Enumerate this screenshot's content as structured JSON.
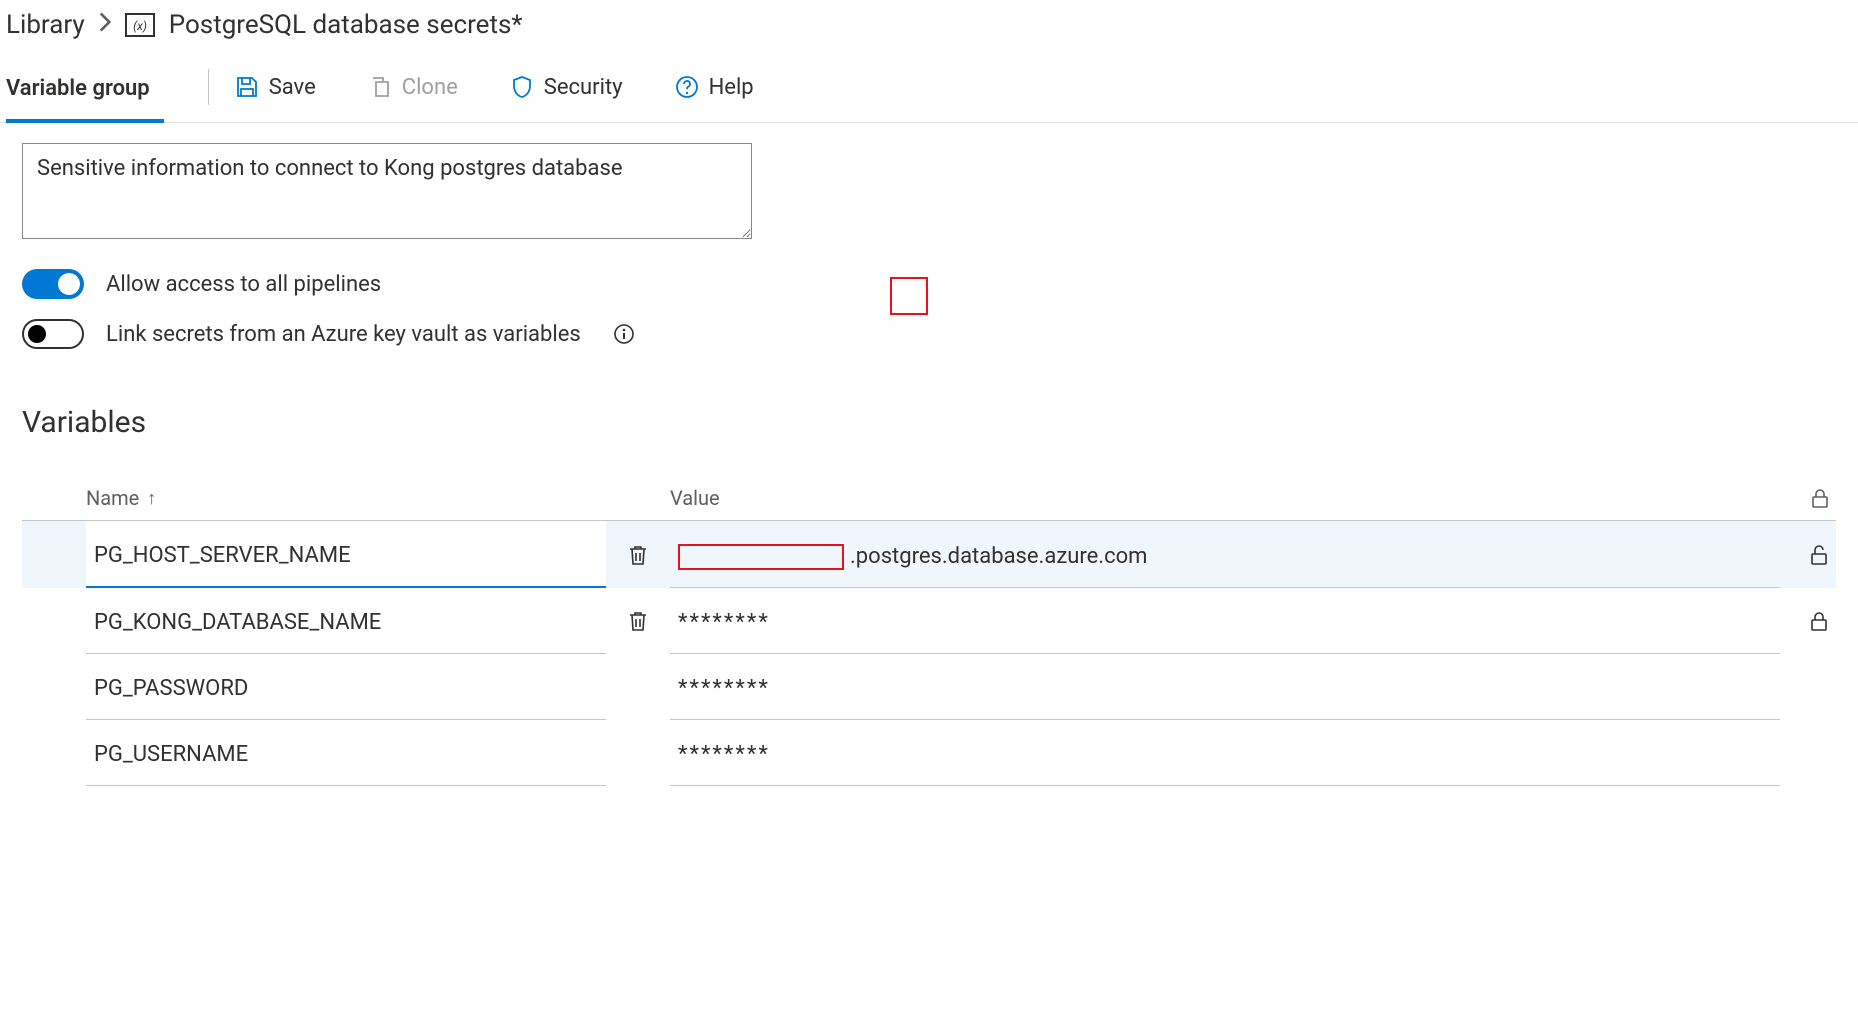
{
  "breadcrumb": {
    "root": "Library",
    "title": "PostgreSQL database secrets*"
  },
  "tab": {
    "label": "Variable group"
  },
  "toolbar": {
    "save": "Save",
    "clone": "Clone",
    "security": "Security",
    "help": "Help"
  },
  "description": "Sensitive information to connect to Kong postgres database",
  "toggles": {
    "allow_access": "Allow access to all pipelines",
    "link_kv": "Link secrets from an Azure key vault as variables"
  },
  "section_header": "Variables",
  "columns": {
    "name": "Name",
    "value": "Value"
  },
  "rows": [
    {
      "name": "PG_HOST_SERVER_NAME",
      "value": ".postgres.database.azure.com",
      "masked": false,
      "locked": false,
      "selected": true,
      "delete": true,
      "redact_left": true
    },
    {
      "name": "PG_KONG_DATABASE_NAME",
      "value": "********",
      "masked": true,
      "locked": true,
      "selected": false,
      "delete": true
    },
    {
      "name": "PG_PASSWORD",
      "value": "********",
      "masked": true,
      "locked": false,
      "selected": false,
      "delete": false
    },
    {
      "name": "PG_USERNAME",
      "value": "********",
      "masked": true,
      "locked": false,
      "selected": false,
      "delete": false
    }
  ]
}
